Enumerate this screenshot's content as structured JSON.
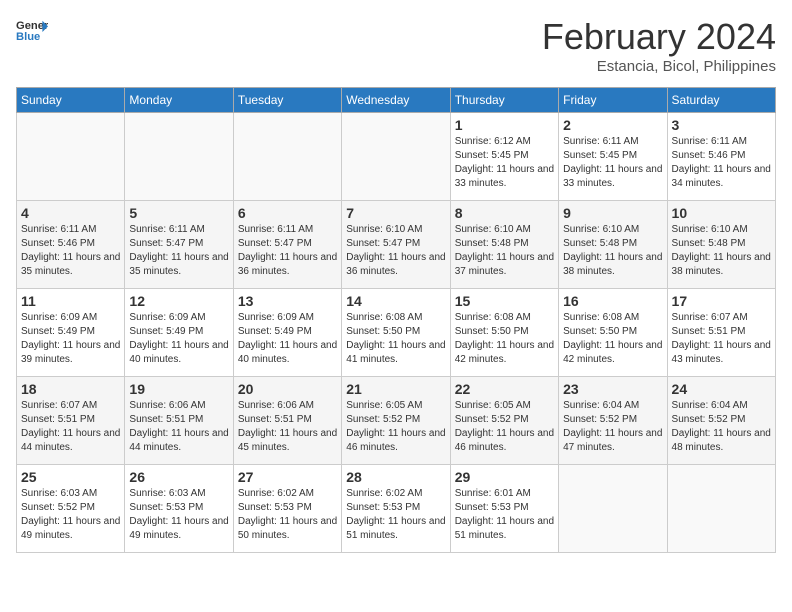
{
  "logo": {
    "line1": "General",
    "line2": "Blue"
  },
  "title": "February 2024",
  "subtitle": "Estancia, Bicol, Philippines",
  "days_of_week": [
    "Sunday",
    "Monday",
    "Tuesday",
    "Wednesday",
    "Thursday",
    "Friday",
    "Saturday"
  ],
  "weeks": [
    [
      {
        "day": "",
        "info": ""
      },
      {
        "day": "",
        "info": ""
      },
      {
        "day": "",
        "info": ""
      },
      {
        "day": "",
        "info": ""
      },
      {
        "day": "1",
        "info": "Sunrise: 6:12 AM\nSunset: 5:45 PM\nDaylight: 11 hours and 33 minutes."
      },
      {
        "day": "2",
        "info": "Sunrise: 6:11 AM\nSunset: 5:45 PM\nDaylight: 11 hours and 33 minutes."
      },
      {
        "day": "3",
        "info": "Sunrise: 6:11 AM\nSunset: 5:46 PM\nDaylight: 11 hours and 34 minutes."
      }
    ],
    [
      {
        "day": "4",
        "info": "Sunrise: 6:11 AM\nSunset: 5:46 PM\nDaylight: 11 hours and 35 minutes."
      },
      {
        "day": "5",
        "info": "Sunrise: 6:11 AM\nSunset: 5:47 PM\nDaylight: 11 hours and 35 minutes."
      },
      {
        "day": "6",
        "info": "Sunrise: 6:11 AM\nSunset: 5:47 PM\nDaylight: 11 hours and 36 minutes."
      },
      {
        "day": "7",
        "info": "Sunrise: 6:10 AM\nSunset: 5:47 PM\nDaylight: 11 hours and 36 minutes."
      },
      {
        "day": "8",
        "info": "Sunrise: 6:10 AM\nSunset: 5:48 PM\nDaylight: 11 hours and 37 minutes."
      },
      {
        "day": "9",
        "info": "Sunrise: 6:10 AM\nSunset: 5:48 PM\nDaylight: 11 hours and 38 minutes."
      },
      {
        "day": "10",
        "info": "Sunrise: 6:10 AM\nSunset: 5:48 PM\nDaylight: 11 hours and 38 minutes."
      }
    ],
    [
      {
        "day": "11",
        "info": "Sunrise: 6:09 AM\nSunset: 5:49 PM\nDaylight: 11 hours and 39 minutes."
      },
      {
        "day": "12",
        "info": "Sunrise: 6:09 AM\nSunset: 5:49 PM\nDaylight: 11 hours and 40 minutes."
      },
      {
        "day": "13",
        "info": "Sunrise: 6:09 AM\nSunset: 5:49 PM\nDaylight: 11 hours and 40 minutes."
      },
      {
        "day": "14",
        "info": "Sunrise: 6:08 AM\nSunset: 5:50 PM\nDaylight: 11 hours and 41 minutes."
      },
      {
        "day": "15",
        "info": "Sunrise: 6:08 AM\nSunset: 5:50 PM\nDaylight: 11 hours and 42 minutes."
      },
      {
        "day": "16",
        "info": "Sunrise: 6:08 AM\nSunset: 5:50 PM\nDaylight: 11 hours and 42 minutes."
      },
      {
        "day": "17",
        "info": "Sunrise: 6:07 AM\nSunset: 5:51 PM\nDaylight: 11 hours and 43 minutes."
      }
    ],
    [
      {
        "day": "18",
        "info": "Sunrise: 6:07 AM\nSunset: 5:51 PM\nDaylight: 11 hours and 44 minutes."
      },
      {
        "day": "19",
        "info": "Sunrise: 6:06 AM\nSunset: 5:51 PM\nDaylight: 11 hours and 44 minutes."
      },
      {
        "day": "20",
        "info": "Sunrise: 6:06 AM\nSunset: 5:51 PM\nDaylight: 11 hours and 45 minutes."
      },
      {
        "day": "21",
        "info": "Sunrise: 6:05 AM\nSunset: 5:52 PM\nDaylight: 11 hours and 46 minutes."
      },
      {
        "day": "22",
        "info": "Sunrise: 6:05 AM\nSunset: 5:52 PM\nDaylight: 11 hours and 46 minutes."
      },
      {
        "day": "23",
        "info": "Sunrise: 6:04 AM\nSunset: 5:52 PM\nDaylight: 11 hours and 47 minutes."
      },
      {
        "day": "24",
        "info": "Sunrise: 6:04 AM\nSunset: 5:52 PM\nDaylight: 11 hours and 48 minutes."
      }
    ],
    [
      {
        "day": "25",
        "info": "Sunrise: 6:03 AM\nSunset: 5:52 PM\nDaylight: 11 hours and 49 minutes."
      },
      {
        "day": "26",
        "info": "Sunrise: 6:03 AM\nSunset: 5:53 PM\nDaylight: 11 hours and 49 minutes."
      },
      {
        "day": "27",
        "info": "Sunrise: 6:02 AM\nSunset: 5:53 PM\nDaylight: 11 hours and 50 minutes."
      },
      {
        "day": "28",
        "info": "Sunrise: 6:02 AM\nSunset: 5:53 PM\nDaylight: 11 hours and 51 minutes."
      },
      {
        "day": "29",
        "info": "Sunrise: 6:01 AM\nSunset: 5:53 PM\nDaylight: 11 hours and 51 minutes."
      },
      {
        "day": "",
        "info": ""
      },
      {
        "day": "",
        "info": ""
      }
    ]
  ]
}
